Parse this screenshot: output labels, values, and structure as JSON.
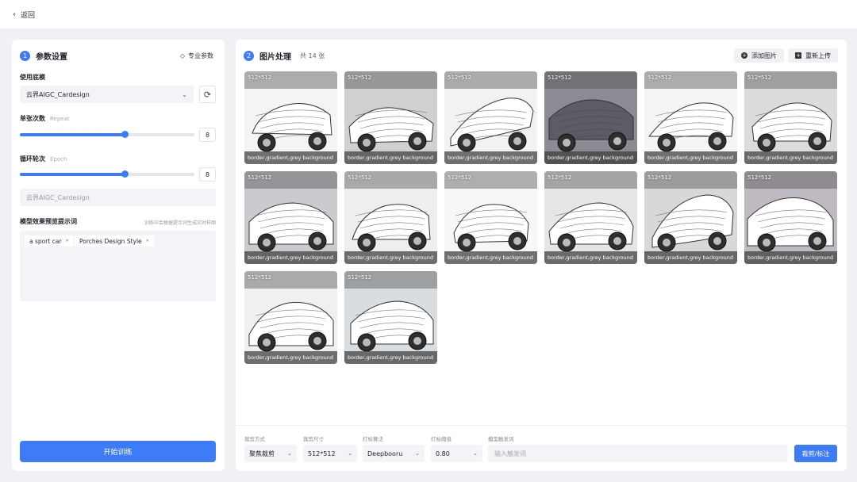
{
  "topbar": {
    "back_label": "返回"
  },
  "left": {
    "step": "1",
    "title": "参数设置",
    "pro_label": "专业参数",
    "model_label": "使用底模",
    "model_value": "云界AIGC_Cardesign",
    "repeat_label": "单张次数",
    "repeat_sub": "Repeat",
    "repeat_value": "8",
    "repeat_fraction": 0.6,
    "epoch_label": "循环轮次",
    "epoch_sub": "Epoch",
    "epoch_value": "8",
    "epoch_fraction": 0.6,
    "model_readonly": "云界AIGC_Cardesign",
    "prompt_label": "模型效果预览提示词",
    "prompt_hint": "训练中会根据提示词生成实时样图",
    "tags": [
      "a sport car",
      "Porches Design Style"
    ],
    "train_label": "开始训练"
  },
  "right": {
    "step": "2",
    "title": "图片处理",
    "count": "共 14 张",
    "add_label": "添加图片",
    "reupload_label": "重新上传",
    "images": [
      {
        "size": "512*512",
        "caption": "border,gradient,grey background"
      },
      {
        "size": "512*512",
        "caption": "border,gradient,grey background"
      },
      {
        "size": "512*512",
        "caption": "border,gradient,grey background"
      },
      {
        "size": "512*512",
        "caption": "border,gradient,grey background"
      },
      {
        "size": "512*512",
        "caption": "border,gradient,grey background"
      },
      {
        "size": "512*512",
        "caption": "border,gradient,grey background"
      },
      {
        "size": "512*512",
        "caption": "border,gradient,grey background"
      },
      {
        "size": "512*512",
        "caption": "border,gradient,grey background"
      },
      {
        "size": "512*512",
        "caption": "border,gradient,grey background"
      },
      {
        "size": "512*512",
        "caption": "border,gradient,grey background"
      },
      {
        "size": "512*512",
        "caption": "border,gradient,grey background"
      },
      {
        "size": "512*512",
        "caption": "border,gradient,grey background"
      },
      {
        "size": "512*512",
        "caption": "border,gradient,grey background"
      },
      {
        "size": "512*512",
        "caption": "border,gradient,grey background"
      }
    ],
    "footer": {
      "crop_mode_label": "裁剪方式",
      "crop_mode_value": "聚焦裁剪",
      "crop_size_label": "裁剪尺寸",
      "crop_size_value": "512*512",
      "tag_algo_label": "打标算法",
      "tag_algo_value": "Deepbooru",
      "threshold_label": "打标阈值",
      "threshold_value": "0.80",
      "trigger_label": "模型触发词",
      "trigger_placeholder": "输入触发词",
      "crop_button": "裁剪/标注"
    }
  },
  "colors": {
    "accent": "#3d7cf6",
    "background": "#f0f1f5",
    "panel": "#ffffff"
  }
}
